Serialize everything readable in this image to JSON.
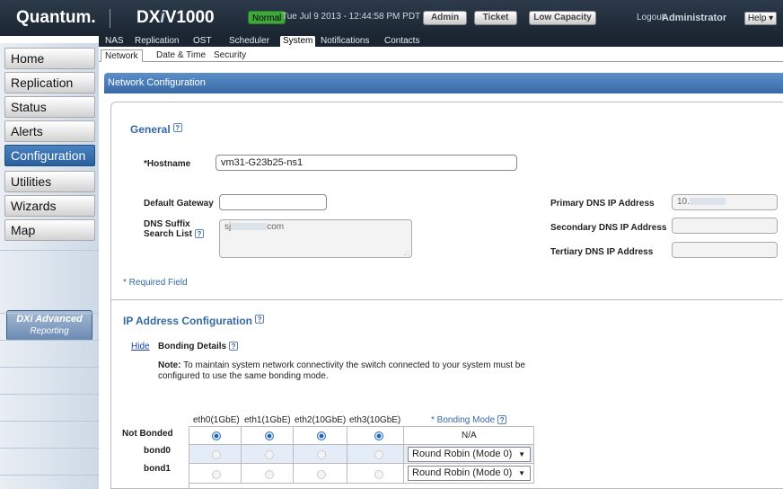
{
  "header": {
    "logo": "Quantum.",
    "product_prefix": "DX",
    "product_italic": "i",
    "product_suffix": "V1000",
    "status": "Normal",
    "timestamp": "Tue Jul 9 2013 - 12:44:58 PM PDT",
    "admin_label": "Admin",
    "ticket_label": "Ticket",
    "capacity_label": "Low Capacity",
    "logout_label": "Logout",
    "user": "Administrator",
    "help_label": "Help ▾"
  },
  "subtabs": [
    "NAS",
    "Replication",
    "OST",
    "Scheduler",
    "System",
    "Notifications",
    "Contacts"
  ],
  "sidebar": {
    "items": [
      "Home",
      "Replication",
      "Status",
      "Alerts",
      "Configuration",
      "Utilities",
      "Wizards",
      "Map"
    ],
    "active": "Configuration",
    "advanced_title": "DXi Advanced",
    "advanced_sub": "Reporting"
  },
  "tabs2": [
    "Network",
    "Date & Time",
    "Security"
  ],
  "section_title": "Network Configuration",
  "general": {
    "title": "General",
    "hostname_label": "*Hostname",
    "hostname_value": "vm31-G23b25-ns1",
    "gateway_label": "Default Gateway",
    "gateway_value": "",
    "dns_suffix_label1": "DNS Suffix",
    "dns_suffix_label2": "Search List",
    "dns_suffix_prefix": "sj",
    "dns_suffix_suffix": "com",
    "primary_dns_label": "Primary DNS IP Address",
    "primary_dns_value": "10.",
    "secondary_dns_label": "Secondary DNS IP Address",
    "tertiary_dns_label": "Tertiary DNS IP Address",
    "required_note": "* Required Field"
  },
  "ip": {
    "title": "IP Address Configuration",
    "hide_link": "Hide",
    "bonding_details": "Bonding Details",
    "note_bold": "Note:",
    "note_line1": " To maintain system network connectivity the switch connected to your system must be",
    "note_line2": "configured to use the same bonding mode.",
    "columns": [
      "eth0(1GbE)",
      "eth1(1GbE)",
      "eth2(10GbE)",
      "eth3(10GbE)"
    ],
    "mode_header": "* Bonding Mode",
    "rows": [
      {
        "label": "Not Bonded",
        "radios": [
          true,
          true,
          true,
          true
        ],
        "mode": "N/A"
      },
      {
        "label": "bond0",
        "radios": [
          false,
          false,
          false,
          false
        ],
        "mode": "Round Robin (Mode 0)"
      },
      {
        "label": "bond1",
        "radios": [
          false,
          false,
          false,
          false
        ],
        "mode": "Round Robin (Mode 0)"
      }
    ]
  }
}
